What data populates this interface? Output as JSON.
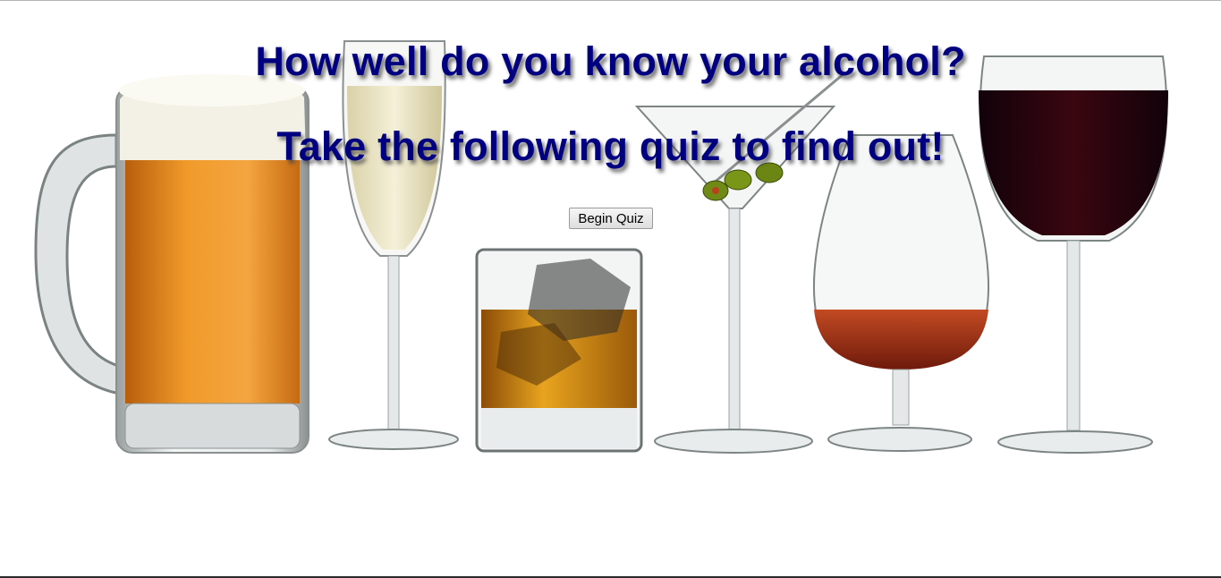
{
  "heading": {
    "line1": "How well do you know your alcohol?",
    "line2": "Take the following quiz to find out!",
    "color": "#000080"
  },
  "actions": {
    "begin_label": "Begin Quiz"
  },
  "background_image": {
    "subject": "beer-mug, champagne-flute, whiskey-tumbler, martini-glass, brandy-snifter, red-wine-glass",
    "colors": {
      "beer": "#e88a1c",
      "champagne": "#ece6c6",
      "whiskey": "#d9951a",
      "brandy": "#a2371b",
      "red_wine": "#2a0408"
    }
  }
}
